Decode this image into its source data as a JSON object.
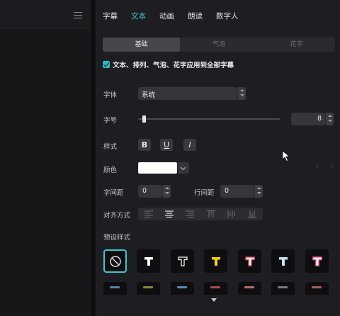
{
  "tabs": [
    {
      "label": "字幕",
      "active": false
    },
    {
      "label": "文本",
      "active": true
    },
    {
      "label": "动画",
      "active": false
    },
    {
      "label": "朗读",
      "active": false
    },
    {
      "label": "数字人",
      "active": false
    }
  ],
  "subtabs": [
    {
      "label": "基础",
      "active": true
    },
    {
      "label": "气泡",
      "active": false
    },
    {
      "label": "花字",
      "active": false
    }
  ],
  "apply_all": {
    "label": "文本、排列、气泡、花字应用到全部字幕",
    "checked": true
  },
  "font": {
    "label": "字体",
    "value": "系统"
  },
  "size": {
    "label": "字号",
    "value": "8",
    "slider_fraction": 0.03
  },
  "style": {
    "label": "样式",
    "buttons": [
      {
        "name": "bold",
        "glyph": "B"
      },
      {
        "name": "underline",
        "glyph": "U"
      },
      {
        "name": "italic",
        "glyph": "I"
      }
    ]
  },
  "color": {
    "label": "颜色",
    "value": "#ffffff"
  },
  "char_spacing": {
    "label": "字间距",
    "value": "0"
  },
  "line_spacing": {
    "label": "行间距",
    "value": "0"
  },
  "align": {
    "label": "对齐方式",
    "icons": [
      "align-left-icon",
      "align-center-icon",
      "align-right-icon",
      "align-top-icon",
      "align-middle-icon",
      "align-bottom-icon"
    ],
    "selected": 1
  },
  "presets": {
    "label": "预设样式",
    "items": [
      {
        "name": "none",
        "color": "#e6e6ea"
      },
      {
        "name": "white-black-outline",
        "color": "#ffffff"
      },
      {
        "name": "black-white-outline",
        "color": "#0e0e11"
      },
      {
        "name": "yellow",
        "color": "#f5d315"
      },
      {
        "name": "white-red-outline",
        "color": "#ffffff"
      },
      {
        "name": "light-blue",
        "color": "#bfe4f5"
      },
      {
        "name": "white-pink-outline",
        "color": "#ffffff"
      }
    ],
    "row2_colors": [
      "#5a7fa8",
      "#8a8a40",
      "#5a8ab8",
      "#a05050",
      "#b07070",
      "#7a7a80",
      "#a06060"
    ]
  },
  "colors": {
    "accent": "#3fc7cf",
    "panel": "#1e1e22",
    "control": "#35353b"
  }
}
